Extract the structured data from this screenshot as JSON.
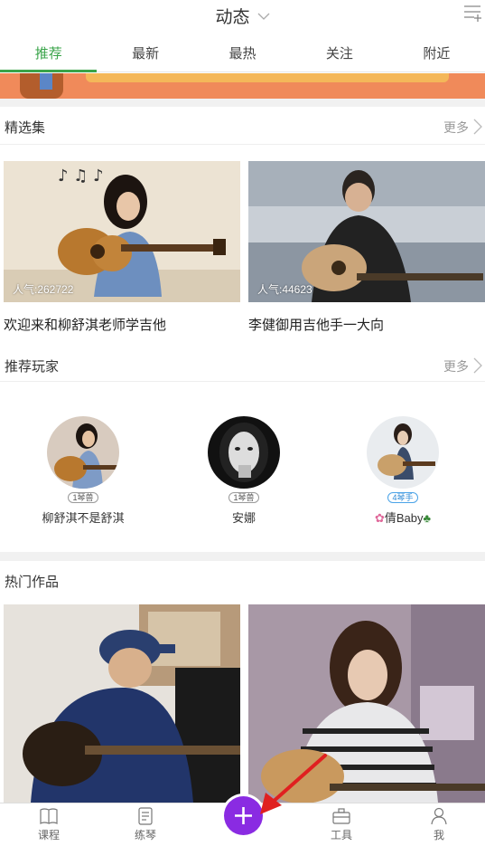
{
  "header": {
    "title": "动态",
    "menu_icon": "menu-add-icon"
  },
  "tabs": [
    {
      "label": "推荐",
      "active": true
    },
    {
      "label": "最新",
      "active": false
    },
    {
      "label": "最热",
      "active": false
    },
    {
      "label": "关注",
      "active": false
    },
    {
      "label": "附近",
      "active": false
    }
  ],
  "featured": {
    "title": "精选集",
    "more": "更多",
    "items": [
      {
        "popularity": "人气:262722",
        "caption": "欢迎来和柳舒淇老师学吉他"
      },
      {
        "popularity": "人气:44623",
        "caption": "李健御用吉他手一大向"
      }
    ]
  },
  "players": {
    "title": "推荐玩家",
    "more": "更多",
    "items": [
      {
        "name": "柳舒淇不是舒淇",
        "badge": "1琴兽"
      },
      {
        "name": "安娜",
        "badge": "1琴兽"
      },
      {
        "name": "倩Baby",
        "badge": "4琴手"
      }
    ]
  },
  "hot": {
    "title": "热门作品"
  },
  "nav": {
    "items": [
      {
        "label": "课程",
        "icon": "book-icon"
      },
      {
        "label": "练琴",
        "icon": "practice-icon"
      },
      {
        "label": "工具",
        "icon": "toolbox-icon"
      },
      {
        "label": "我",
        "icon": "person-icon"
      }
    ],
    "fab_icon": "plus-icon"
  },
  "colors": {
    "accent": "#3aa44a",
    "fab": "#8a2be2",
    "annotation": "#e02020"
  }
}
